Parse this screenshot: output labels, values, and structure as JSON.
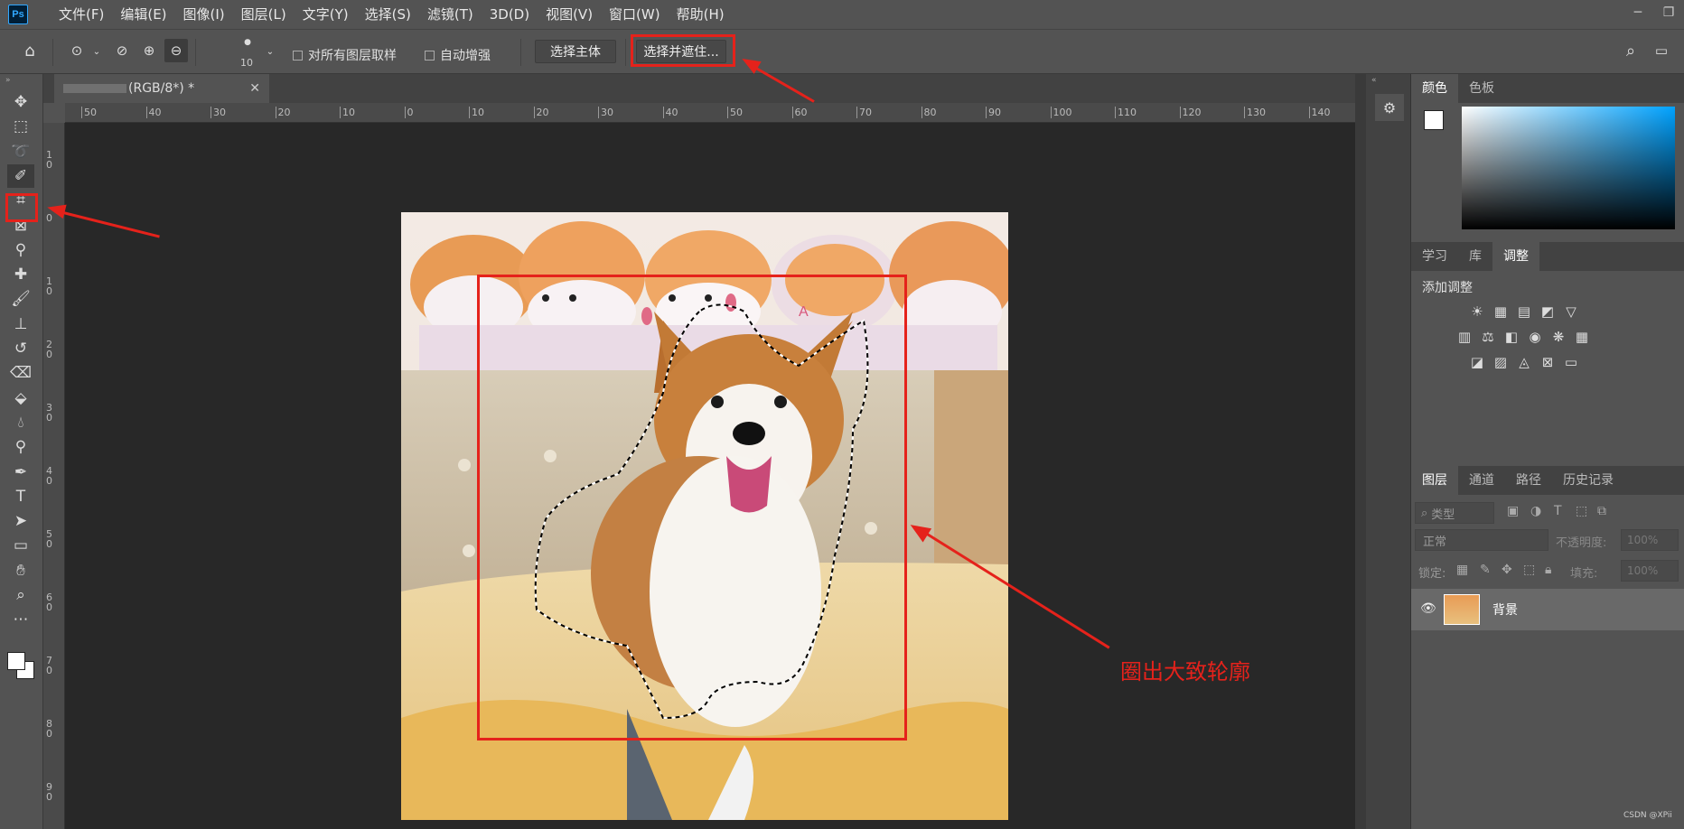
{
  "app": {
    "logo": "Ps"
  },
  "menu": [
    "文件(F)",
    "编辑(E)",
    "图像(I)",
    "图层(L)",
    "文字(Y)",
    "选择(S)",
    "滤镜(T)",
    "3D(D)",
    "视图(V)",
    "窗口(W)",
    "帮助(H)"
  ],
  "options": {
    "brush_size": "10",
    "sample_all_layers": "对所有图层取样",
    "auto_enhance": "自动增强",
    "select_subject": "选择主体",
    "select_and_mask": "选择并遮住..."
  },
  "document": {
    "tab_title": "(RGB/8*) *"
  },
  "ruler_h": [
    "50",
    "40",
    "30",
    "20",
    "10",
    "0",
    "10",
    "20",
    "30",
    "40",
    "50",
    "60",
    "70",
    "80",
    "90",
    "100",
    "110",
    "120",
    "130",
    "140"
  ],
  "ruler_v": [
    "1 0",
    "0",
    "1 0",
    "2 0",
    "3 0",
    "4 0",
    "5 0",
    "6 0",
    "7 0",
    "8 0",
    "9 0"
  ],
  "color_panel": {
    "tabs": [
      "颜色",
      "色板"
    ],
    "active": 0
  },
  "adjust_panel": {
    "tabs": [
      "学习",
      "库",
      "调整"
    ],
    "active": 2,
    "heading": "添加调整"
  },
  "layers_panel": {
    "tabs": [
      "图层",
      "通道",
      "路径",
      "历史记录"
    ],
    "active": 0,
    "filter_placeholder": "类型",
    "blend_mode": "正常",
    "opacity_label": "不透明度:",
    "opacity_value": "100%",
    "lock_label": "锁定:",
    "fill_label": "填充:",
    "fill_value": "100%",
    "layers": [
      {
        "name": "背景",
        "visible": true
      }
    ]
  },
  "annotation": {
    "text": "圈出大致轮廓"
  },
  "watermark": "CSDN @XPii",
  "colors": {
    "annotation_red": "#e5221b",
    "ps_blue": "#31a8ff"
  }
}
